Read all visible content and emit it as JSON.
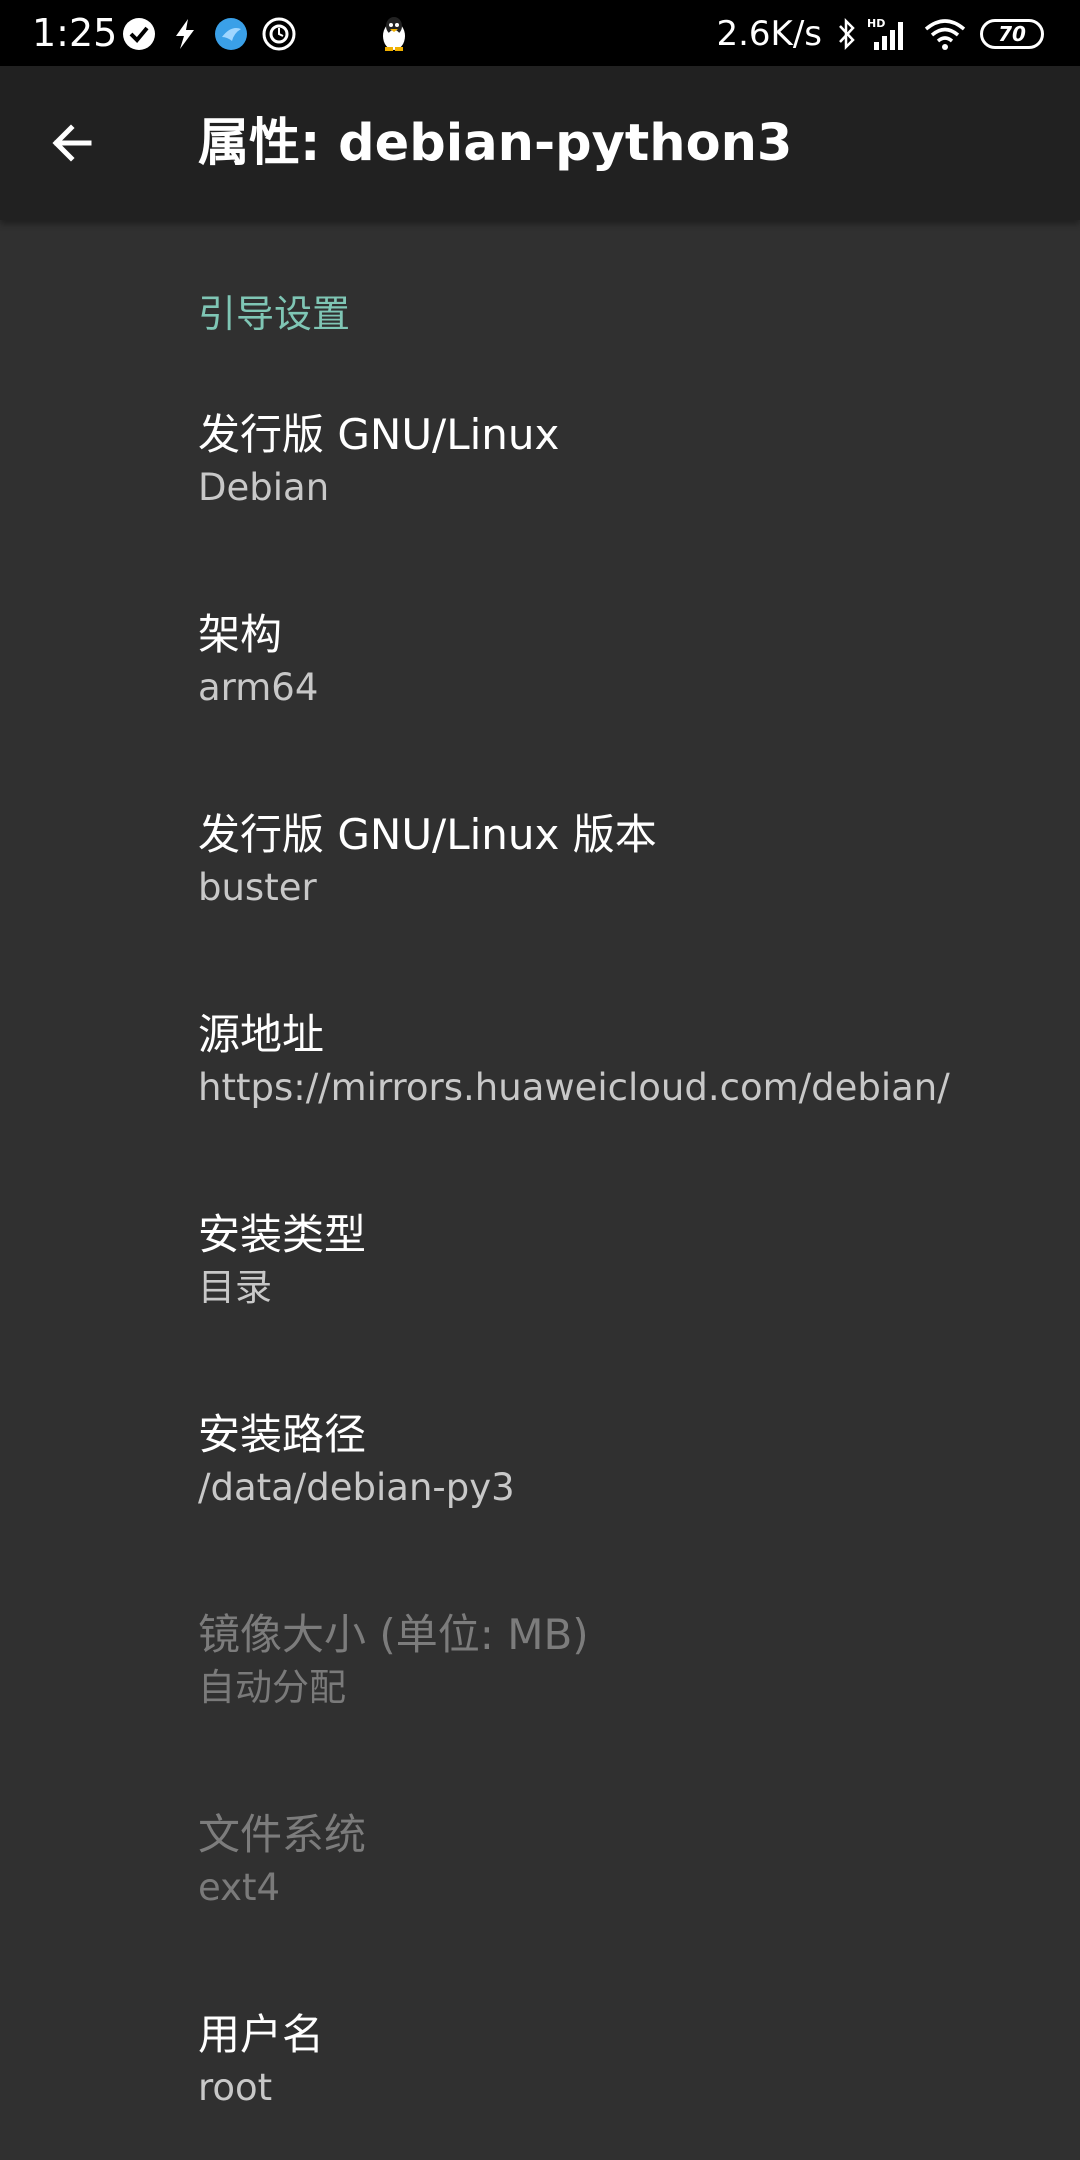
{
  "status_bar": {
    "time": "1:25",
    "network_speed": "2.6K/s",
    "network_type": "HD",
    "battery_level": "70",
    "icons_left": [
      "check-circle-icon",
      "lightning-icon",
      "bird-app-icon",
      "clock-app-icon",
      "penguin-icon"
    ],
    "icons_right": [
      "bluetooth-icon",
      "cellular-signal-icon",
      "wifi-icon",
      "battery-icon"
    ]
  },
  "app_bar": {
    "title": "属性: debian-python3",
    "back_icon": "arrow-back-icon"
  },
  "section": {
    "title": "引导设置"
  },
  "preferences": [
    {
      "title": "发行版 GNU/Linux",
      "summary": "Debian",
      "enabled": true
    },
    {
      "title": "架构",
      "summary": "arm64",
      "enabled": true
    },
    {
      "title": "发行版 GNU/Linux 版本",
      "summary": "buster",
      "enabled": true
    },
    {
      "title": "源地址",
      "summary": "https://mirrors.huaweicloud.com/debian/",
      "enabled": true
    },
    {
      "title": "安装类型",
      "summary": "目录",
      "enabled": true
    },
    {
      "title": "安装路径",
      "summary": "/data/debian-py3",
      "enabled": true
    },
    {
      "title": "镜像大小 (单位: MB)",
      "summary": "自动分配",
      "enabled": false
    },
    {
      "title": "文件系统",
      "summary": "ext4",
      "enabled": false
    },
    {
      "title": "用户名",
      "summary": "root",
      "enabled": true
    }
  ],
  "colors": {
    "background": "#303030",
    "app_bar": "#212121",
    "status_bar": "#000000",
    "accent": "#7fc6b5"
  }
}
